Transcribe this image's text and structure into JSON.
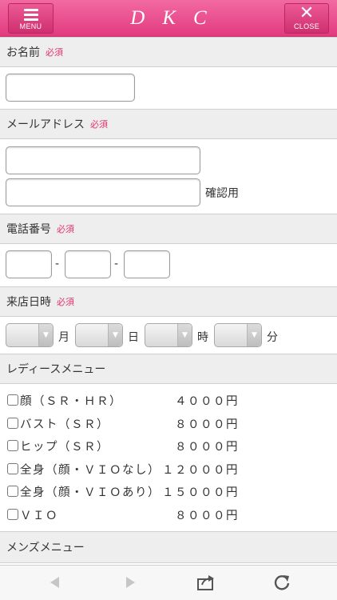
{
  "header": {
    "menu_label": "MENU",
    "logo": "DKC",
    "close_label": "CLOSE"
  },
  "form": {
    "required": "必須",
    "name": {
      "label": "お名前",
      "value": ""
    },
    "email": {
      "label": "メールアドレス",
      "value": "",
      "confirm_value": "",
      "confirm_label": "確認用"
    },
    "phone": {
      "label": "電話番号",
      "sep": "-"
    },
    "visit": {
      "label": "来店日時",
      "month": "月",
      "day": "日",
      "hour": "時",
      "minute": "分"
    }
  },
  "ladies_menu": {
    "title": "レディースメニュー",
    "items": [
      {
        "name": "顔（ＳＲ・ＨＲ）",
        "price": "４０００円",
        "checked": false
      },
      {
        "name": "バスト（ＳＲ）",
        "price": "８０００円",
        "checked": false
      },
      {
        "name": "ヒップ（ＳＲ）",
        "price": "８０００円",
        "checked": false
      },
      {
        "name": "全身（顔・ＶＩＯなし）",
        "price": "１２０００円",
        "checked": false
      },
      {
        "name": "全身（顔・ＶＩＯあり）",
        "price": "１５０００円",
        "checked": false
      },
      {
        "name": "ＶＩＯ",
        "price": "８０００円",
        "checked": false
      }
    ]
  },
  "mens_menu": {
    "title": "メンズメニュー"
  },
  "toolbar": {
    "icons": [
      "back-arrow-icon",
      "forward-arrow-icon",
      "share-icon",
      "reload-icon"
    ]
  }
}
